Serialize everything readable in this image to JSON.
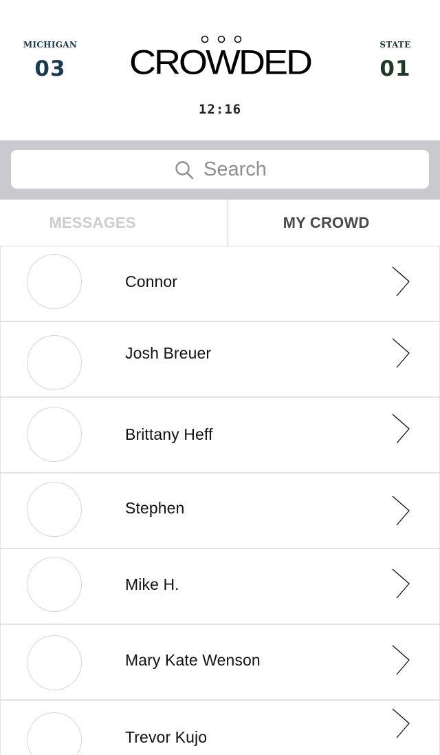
{
  "header": {
    "home_team": {
      "name": "MICHIGAN",
      "score": "03",
      "color": "#1a3a52"
    },
    "away_team": {
      "name": "STATE",
      "score": "01",
      "color": "#1d3a27"
    },
    "logo_text": "CROWDED",
    "clock": "12:16"
  },
  "search": {
    "placeholder": "Search",
    "icon": "search-icon"
  },
  "tabs": [
    {
      "label": "MESSAGES",
      "active": false
    },
    {
      "label": "MY CROWD",
      "active": true
    }
  ],
  "contacts": [
    {
      "name": "Connor"
    },
    {
      "name": "Josh Breuer"
    },
    {
      "name": "Brittany Heff"
    },
    {
      "name": "Stephen"
    },
    {
      "name": "Mike H."
    },
    {
      "name": "Mary Kate Wenson"
    },
    {
      "name": "Trevor Kujo"
    }
  ],
  "colors": {
    "search_bar_bg": "#c9cacf",
    "inactive_tab": "#cccccc",
    "active_tab": "#4a4a4a"
  }
}
